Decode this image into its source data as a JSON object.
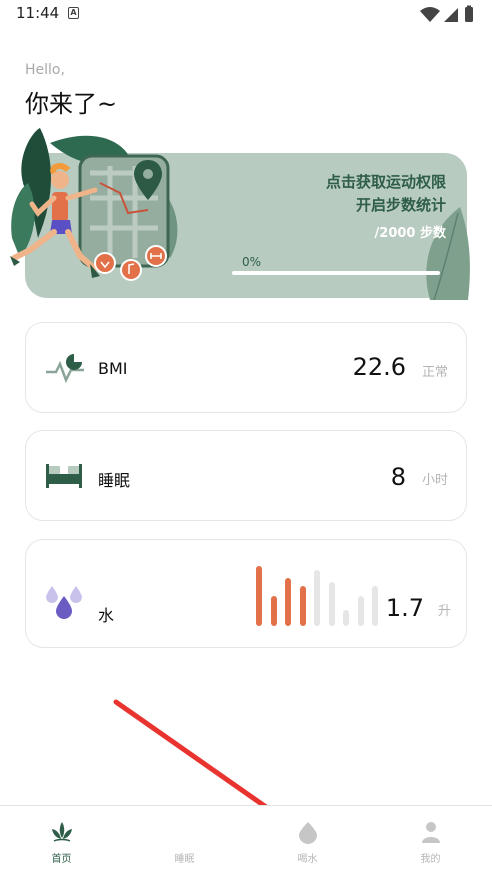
{
  "status_bar": {
    "time": "11:44",
    "notification_letter": "A"
  },
  "greeting": {
    "hello": "Hello,",
    "title": "你来了~"
  },
  "banner": {
    "line1": "点击获取运动权限",
    "line2": "开启步数统计",
    "steps": "/2000 步数",
    "progress_label": "0%",
    "progress_value": 0,
    "background_color": "#b8cbc0",
    "text_color": "#2f5e48"
  },
  "cards": {
    "bmi": {
      "label": "BMI",
      "value": "22.6",
      "unit": "正常"
    },
    "sleep": {
      "label": "睡眠",
      "value": "8",
      "unit": "小时"
    },
    "water": {
      "label": "水",
      "value": "1.7",
      "unit": "升",
      "bars": [
        {
          "level": 1.0,
          "filled": true
        },
        {
          "level": 0.5,
          "filled": true
        },
        {
          "level": 0.8,
          "filled": true
        },
        {
          "level": 0.67,
          "filled": true
        },
        {
          "level": 0.93,
          "filled": false
        },
        {
          "level": 0.73,
          "filled": false
        },
        {
          "level": 0.27,
          "filled": false
        },
        {
          "level": 0.5,
          "filled": false
        },
        {
          "level": 0.67,
          "filled": false
        }
      ],
      "filled_color": "#e2714a",
      "empty_color": "#e6e6e6"
    }
  },
  "nav": {
    "items": [
      {
        "label": "首页",
        "icon": "leaf-icon",
        "active": true
      },
      {
        "label": "睡眠",
        "icon": "moon-icon",
        "active": false
      },
      {
        "label": "喝水",
        "icon": "water-drop-icon",
        "active": false
      },
      {
        "label": "我的",
        "icon": "user-icon",
        "active": false
      }
    ],
    "active_color": "#2f5e48",
    "inactive_color": "#b5b5b5"
  }
}
